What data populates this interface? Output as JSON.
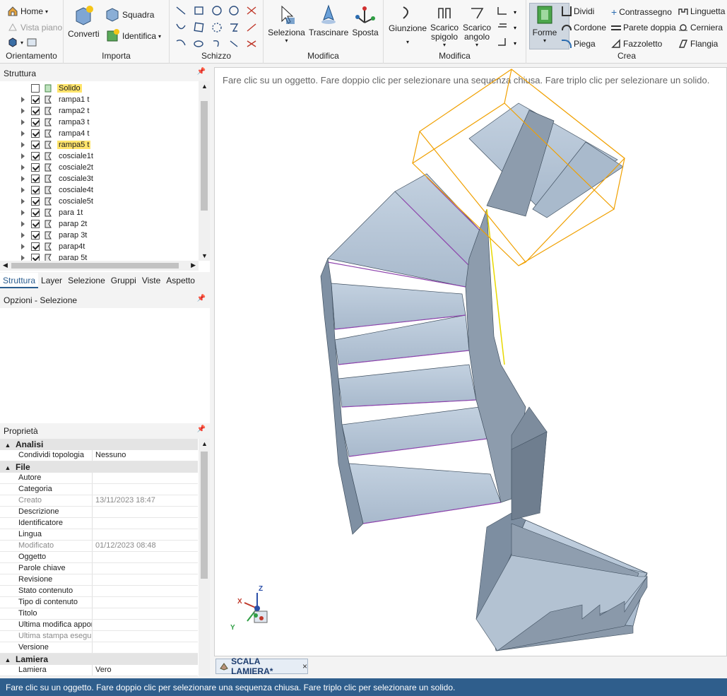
{
  "ribbon": {
    "orient": {
      "home": "Home",
      "vista_piano": "Vista piano",
      "label": "Orientamento"
    },
    "importa": {
      "converti": "Converti",
      "squadra": "Squadra",
      "identifica": "Identifica",
      "label": "Importa"
    },
    "schizzo": {
      "label": "Schizzo"
    },
    "modifica1": {
      "seleziona": "Seleziona",
      "trascinare": "Trascinare",
      "sposta": "Sposta",
      "label": "Modifica"
    },
    "modifica2": {
      "giunzione": "Giunzione",
      "scarico_spigolo_1": "Scarico",
      "scarico_spigolo_2": "spigolo",
      "scarico_angolo_1": "Scarico",
      "scarico_angolo_2": "angolo",
      "label": "Modifica"
    },
    "crea": {
      "forme": "Forme",
      "dividi": "Dividi",
      "cordone": "Cordone",
      "piega": "Piega",
      "contrassegno": "Contrassegno",
      "parete_doppia": "Parete doppia",
      "fazzoletto": "Fazzoletto",
      "linguetta": "Linguetta",
      "cerniera": "Cerniera",
      "flangia": "Flangia",
      "label": "Crea"
    }
  },
  "struttura": {
    "title": "Struttura",
    "items": [
      {
        "label": "Solido",
        "checked": false,
        "highlight": true
      },
      {
        "label": "rampa1 t",
        "checked": true,
        "highlight": false
      },
      {
        "label": "rampa2 t",
        "checked": true,
        "highlight": false
      },
      {
        "label": "rampa3 t",
        "checked": true,
        "highlight": false
      },
      {
        "label": "rampa4 t",
        "checked": true,
        "highlight": false
      },
      {
        "label": "rampa5 t",
        "checked": true,
        "highlight": true
      },
      {
        "label": "cosciale1t",
        "checked": true,
        "highlight": false
      },
      {
        "label": "cosciale2t",
        "checked": true,
        "highlight": false
      },
      {
        "label": "cosciale3t",
        "checked": true,
        "highlight": false
      },
      {
        "label": "cosciale4t",
        "checked": true,
        "highlight": false
      },
      {
        "label": "cosciale5t",
        "checked": true,
        "highlight": false
      },
      {
        "label": "para 1t",
        "checked": true,
        "highlight": false
      },
      {
        "label": "parap 2t",
        "checked": true,
        "highlight": false
      },
      {
        "label": "parap 3t",
        "checked": true,
        "highlight": false
      },
      {
        "label": "parap4t",
        "checked": true,
        "highlight": false
      },
      {
        "label": "parap 5t",
        "checked": true,
        "highlight": false
      }
    ]
  },
  "tabs": [
    "Struttura",
    "Layer",
    "Selezione",
    "Gruppi",
    "Viste",
    "Aspetto"
  ],
  "opzioni": {
    "title": "Opzioni - Selezione"
  },
  "proprieta": {
    "title": "Proprietà",
    "analisi": {
      "label": "Analisi",
      "rows": [
        {
          "k": "Condividi topologia",
          "v": "Nessuno",
          "dim": false
        }
      ]
    },
    "file": {
      "label": "File",
      "rows": [
        {
          "k": "Autore",
          "v": "",
          "dim": false
        },
        {
          "k": "Categoria",
          "v": "",
          "dim": false
        },
        {
          "k": "Creato",
          "v": "13/11/2023 18:47",
          "dim": true
        },
        {
          "k": "Descrizione",
          "v": "",
          "dim": false
        },
        {
          "k": "Identificatore",
          "v": "",
          "dim": false
        },
        {
          "k": "Lingua",
          "v": "",
          "dim": false
        },
        {
          "k": "Modificato",
          "v": "01/12/2023 08:48",
          "dim": true
        },
        {
          "k": "Oggetto",
          "v": "",
          "dim": false
        },
        {
          "k": "Parole chiave",
          "v": "",
          "dim": false
        },
        {
          "k": "Revisione",
          "v": "",
          "dim": false
        },
        {
          "k": "Stato contenuto",
          "v": "",
          "dim": false
        },
        {
          "k": "Tipo di contenuto",
          "v": "",
          "dim": false
        },
        {
          "k": "Titolo",
          "v": "",
          "dim": false
        },
        {
          "k": "Ultima modifica apport",
          "v": "",
          "dim": false
        },
        {
          "k": "Ultima stampa eseguit",
          "v": "",
          "dim": true
        },
        {
          "k": "Versione",
          "v": "",
          "dim": false
        }
      ]
    },
    "lamiera": {
      "label": "Lamiera",
      "rows": [
        {
          "k": "Lamiera",
          "v": "Vero",
          "dim": false
        }
      ]
    }
  },
  "viewport": {
    "hint": "Fare clic su un oggetto. Fare doppio clic per selezionare una sequenza chiusa. Fare triplo clic per selezionare un solido.",
    "axis_x": "X",
    "axis_y": "Y",
    "axis_z": "Z"
  },
  "doc_tab": {
    "label": "SCALA LAMIERA*",
    "close": "×"
  },
  "status": "Fare clic su un oggetto. Fare doppio clic per selezionare una sequenza chiusa. Fare triplo clic per selezionare un solido.",
  "colors": {
    "selection": "#f0b429",
    "face": "#b7c7d8",
    "face_dark": "#8b9aab",
    "edge": "#6a4a7a",
    "status_bg": "#2f5e8c",
    "highlight": "#ffe46b"
  }
}
